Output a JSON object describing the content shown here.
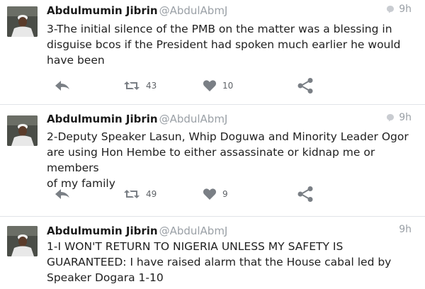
{
  "tweets": [
    {
      "author": "Abdulmumin Jibrin",
      "handle": "@AbdulAbmJ",
      "time": "9h",
      "text": "3-The initial silence of the PMB on the matter was a blessing in\ndisguise bcos if the President had spoken much earlier he would\nhave been",
      "retweets": "43",
      "likes": "10",
      "show_bubble": true
    },
    {
      "author": "Abdulmumin Jibrin",
      "handle": "@AbdulAbmJ",
      "time": "9h",
      "text": "2-Deputy Speaker Lasun, Whip Doguwa and Minority Leader Ogor\nare using Hon Hembe to either assassinate or kidnap me or members\nof my family",
      "retweets": "49",
      "likes": "9",
      "show_bubble": true
    },
    {
      "author": "Abdulmumin Jibrin",
      "handle": "@AbdulAbmJ",
      "time": "9h",
      "text": "1-I WON'T RETURN TO NIGERIA UNLESS MY SAFETY IS\nGUARANTEED: I have raised alarm that the House cabal led by\nSpeaker  Dogara 1-10",
      "show_bubble": false
    }
  ],
  "icons": {
    "reply": "reply-arrow-icon",
    "retweet": "retweet-icon",
    "like": "heart-icon",
    "share": "share-icon",
    "conversation": "speech-bubble-icon"
  },
  "colors": {
    "icon_gray": "#7a7f85",
    "muted_text": "#9aa0a6",
    "divider": "#e1e4e8"
  }
}
